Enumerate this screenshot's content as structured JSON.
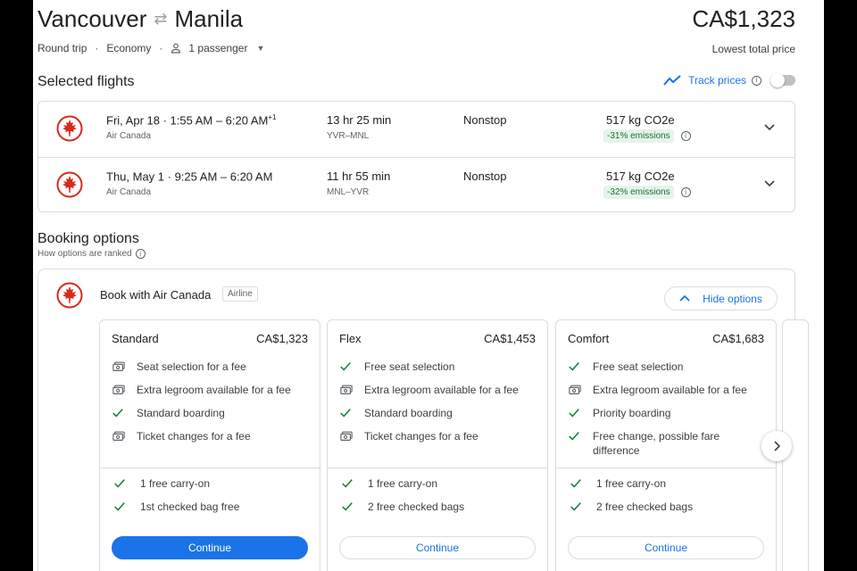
{
  "header": {
    "origin": "Vancouver",
    "destination": "Manila",
    "price": "CA$1,323",
    "trip_type": "Round trip",
    "cabin": "Economy",
    "passengers": "1 passenger",
    "price_note": "Lowest total price"
  },
  "selected": {
    "title": "Selected flights",
    "track_label": "Track prices",
    "flights": [
      {
        "time": "Fri, Apr 18  ·  1:55 AM – 6:20 AM",
        "sup": "+1",
        "airline": "Air Canada",
        "duration": "13 hr 25 min",
        "route": "YVR–MNL",
        "stops": "Nonstop",
        "co2": "517 kg CO2e",
        "emissions": "-31% emissions"
      },
      {
        "time": "Thu, May 1  ·  9:25 AM – 6:20 AM",
        "sup": "",
        "airline": "Air Canada",
        "duration": "11 hr 55 min",
        "route": "MNL–YVR",
        "stops": "Nonstop",
        "co2": "517 kg CO2e",
        "emissions": "-32% emissions"
      }
    ]
  },
  "booking": {
    "title": "Booking options",
    "ranked": "How options are ranked",
    "book_with": "Book with Air Canada",
    "tag": "Airline",
    "hide_label": "Hide options",
    "fares": [
      {
        "name": "Standard",
        "price": "CA$1,323",
        "features": [
          {
            "icon": "fee",
            "text": "Seat selection for a fee"
          },
          {
            "icon": "fee",
            "text": "Extra legroom available for a fee"
          },
          {
            "icon": "check",
            "text": "Standard boarding"
          },
          {
            "icon": "fee",
            "text": "Ticket changes for a fee"
          }
        ],
        "bags": [
          "1 free carry-on",
          "1st checked bag free"
        ],
        "button": "Continue"
      },
      {
        "name": "Flex",
        "price": "CA$1,453",
        "features": [
          {
            "icon": "check",
            "text": "Free seat selection"
          },
          {
            "icon": "fee",
            "text": "Extra legroom available for a fee"
          },
          {
            "icon": "check",
            "text": "Standard boarding"
          },
          {
            "icon": "fee",
            "text": "Ticket changes for a fee"
          }
        ],
        "bags": [
          "1 free carry-on",
          "2 free checked bags"
        ],
        "button": "Continue"
      },
      {
        "name": "Comfort",
        "price": "CA$1,683",
        "features": [
          {
            "icon": "check",
            "text": "Free seat selection"
          },
          {
            "icon": "fee",
            "text": "Extra legroom available for a fee"
          },
          {
            "icon": "check",
            "text": "Priority boarding"
          },
          {
            "icon": "check",
            "text": "Free change, possible fare difference"
          }
        ],
        "bags": [
          "1 free carry-on",
          "2 free checked bags"
        ],
        "button": "Continue"
      }
    ]
  },
  "colors": {
    "accent": "#1a73e8",
    "brand_red": "#d52b1e",
    "check": "#188038"
  }
}
